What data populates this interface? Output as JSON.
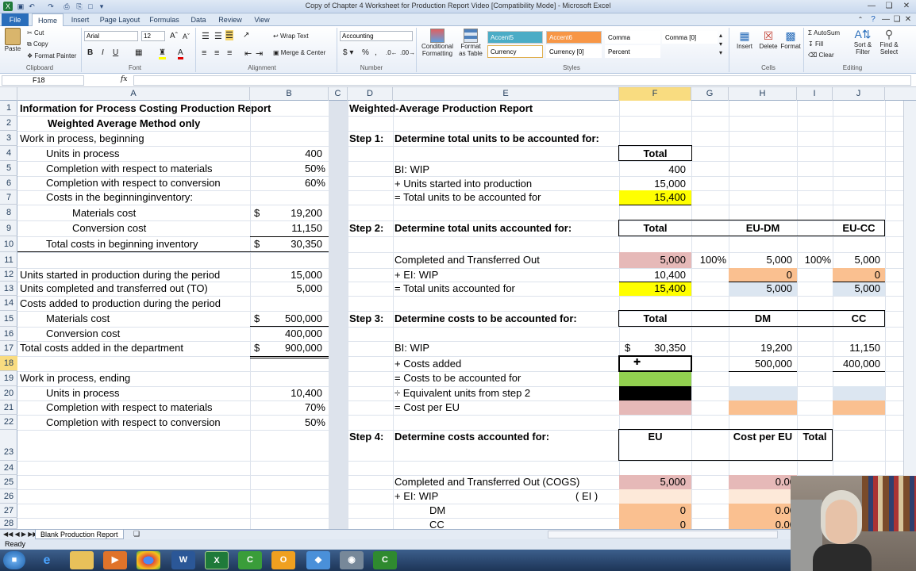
{
  "window": {
    "title": "Copy of Chapter 4 Worksheet for Production Report Video  [Compatibility Mode]  -  Microsoft Excel"
  },
  "ribbon_tabs": [
    "File",
    "Home",
    "Insert",
    "Page Layout",
    "Formulas",
    "Data",
    "Review",
    "View"
  ],
  "ribbon": {
    "clipboard": {
      "paste": "Paste",
      "cut": "Cut",
      "copy": "Copy",
      "format_painter": "Format Painter",
      "label": "Clipboard"
    },
    "font": {
      "name": "Arial",
      "size": "12",
      "label": "Font"
    },
    "alignment": {
      "wrap": "Wrap Text",
      "merge": "Merge & Center",
      "label": "Alignment"
    },
    "number": {
      "format": "Accounting",
      "label": "Number"
    },
    "styles": {
      "conditional": "Conditional Formatting",
      "format_table": "Format as Table",
      "cells": [
        "Accent5",
        "Accent6",
        "Comma",
        "Comma [0]",
        "Currency",
        "Currency [0]",
        "Percent"
      ],
      "label": "Styles"
    },
    "cells_group": {
      "insert": "Insert",
      "delete": "Delete",
      "format": "Format",
      "label": "Cells"
    },
    "editing": {
      "autosum": "AutoSum",
      "fill": "Fill",
      "clear": "Clear",
      "sort": "Sort & Filter",
      "find": "Find & Select",
      "label": "Editing"
    }
  },
  "formula_bar": {
    "name_box": "F18",
    "fx": "fx",
    "content": ""
  },
  "columns": [
    "A",
    "B",
    "C",
    "D",
    "E",
    "F",
    "G",
    "H",
    "I",
    "J"
  ],
  "rows": [
    "1",
    "2",
    "3",
    "4",
    "5",
    "6",
    "7",
    "8",
    "9",
    "10",
    "11",
    "12",
    "13",
    "14",
    "15",
    "16",
    "17",
    "18",
    "19",
    "20",
    "21",
    "22",
    "23",
    "24",
    "25",
    "26",
    "27",
    "28"
  ],
  "left_section": {
    "r1": "Information for Process Costing Production Report",
    "r2": "Weighted Average Method only",
    "r3": "Work in process, beginning",
    "r4": [
      "Units in process",
      "400"
    ],
    "r5": [
      "Completion with respect to materials",
      "50%"
    ],
    "r6": [
      "Completion with respect to conversion",
      "60%"
    ],
    "r7": "Costs in the beginninginventory:",
    "r8": [
      "Materials cost",
      "$",
      "19,200"
    ],
    "r9": [
      "Conversion cost",
      "11,150"
    ],
    "r10": [
      "Total costs in beginning inventory",
      "$",
      "30,350"
    ],
    "r12": [
      "Units started in production during the period",
      "15,000"
    ],
    "r13": [
      "Units completed and transferred out (TO)",
      "5,000"
    ],
    "r14": "Costs added to production during the period",
    "r15": [
      "Materials cost",
      "$",
      "500,000"
    ],
    "r16": [
      "Conversion cost",
      "400,000"
    ],
    "r17": [
      "Total costs added in the department",
      "$",
      "900,000"
    ],
    "r19": "Work in process, ending",
    "r20": [
      "Units in process",
      "10,400"
    ],
    "r21": [
      "Completion with respect to materials",
      "70%"
    ],
    "r22": [
      "Completion with respect to conversion",
      "50%"
    ]
  },
  "report": {
    "title": "Weighted-Average Production Report",
    "step1": {
      "label": "Step 1:",
      "text": "Determine total units to be accounted for:",
      "header": "Total",
      "rows": [
        [
          "BI: WIP",
          "400"
        ],
        [
          "+ Units started into production",
          "15,000"
        ],
        [
          "= Total units to be accounted for",
          "15,400"
        ]
      ]
    },
    "step2": {
      "label": "Step 2:",
      "text": "Determine total units accounted for:",
      "headers": [
        "Total",
        "EU-DM",
        "EU-CC"
      ],
      "rows": [
        [
          "Completed and Transferred Out",
          "5,000",
          "100%",
          "5,000",
          "100%",
          "5,000"
        ],
        [
          "+ EI: WIP",
          "10,400",
          "",
          "0",
          "",
          "0"
        ],
        [
          "= Total units accounted for",
          "15,400",
          "",
          "5,000",
          "",
          "5,000"
        ]
      ]
    },
    "step3": {
      "label": "Step 3:",
      "text": "Determine costs to be accounted for:",
      "headers": [
        "Total",
        "DM",
        "CC"
      ],
      "rows": [
        [
          "BI: WIP",
          "$",
          "30,350",
          "19,200",
          "11,150"
        ],
        [
          "+ Costs added",
          "",
          "",
          "500,000",
          "400,000"
        ],
        [
          "= Costs to be accounted for",
          "",
          "",
          "",
          ""
        ],
        [
          "÷ Equivalent units from step 2",
          "",
          "",
          "",
          ""
        ],
        [
          "= Cost per EU",
          "",
          "",
          "",
          ""
        ]
      ]
    },
    "step4": {
      "label": "Step 4:",
      "text": "Determine costs accounted for:",
      "headers": [
        "EU",
        "Cost per EU",
        "Total"
      ],
      "rows": [
        [
          "Completed and Transferred Out (COGS)",
          "5,000",
          "0.00"
        ],
        [
          "+ EI: WIP",
          "( EI )"
        ],
        [
          "DM",
          "0",
          "0.00"
        ],
        [
          "CC",
          "0",
          "0.00"
        ]
      ]
    }
  },
  "sheet_tab": "Blank Production Report",
  "status": "Ready",
  "taskbar_apps": [
    "start",
    "ie",
    "explorer",
    "media",
    "chrome",
    "word",
    "excel",
    "camtasia",
    "outlook",
    "vpn",
    "webcam",
    "camtasia2"
  ],
  "colors": {
    "pink": "#e6b9b8",
    "yellow": "#ffff00",
    "orange": "#fac090",
    "green": "#92d050",
    "blue_grey": "#dce6f1",
    "selected_header": "#f9dc80"
  }
}
